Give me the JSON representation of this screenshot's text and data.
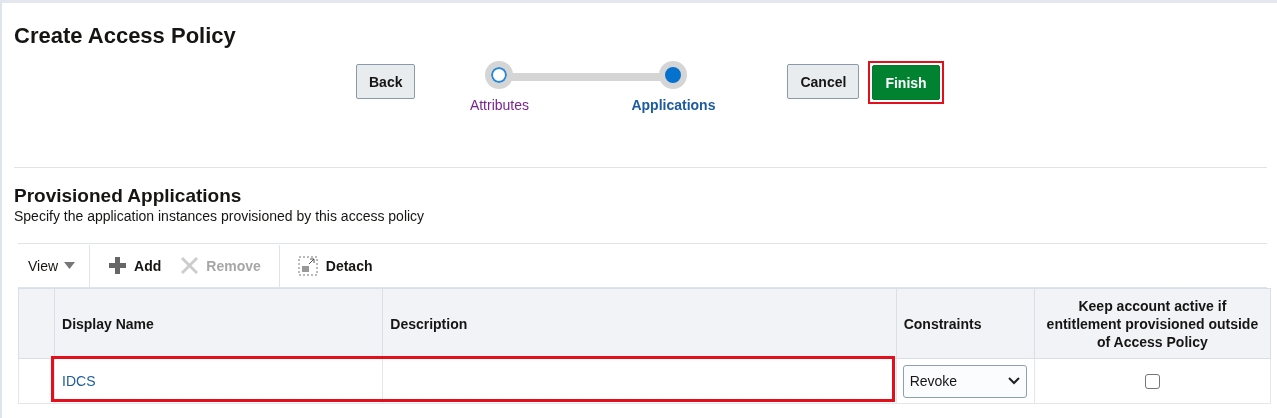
{
  "title": "Create Access Policy",
  "train": {
    "back": "Back",
    "steps": [
      {
        "label": "Attributes",
        "selected": false
      },
      {
        "label": "Applications",
        "selected": true
      }
    ],
    "cancel": "Cancel",
    "finish": {
      "label": "Finish",
      "highlighted": true
    }
  },
  "section": {
    "title": "Provisioned Applications",
    "description": "Specify the application instances provisioned by this access policy"
  },
  "toolbar": {
    "view": "View",
    "items": [
      {
        "kind": "add",
        "label": "Add",
        "disabled": false
      },
      {
        "kind": "remove",
        "label": "Remove",
        "disabled": true
      },
      {
        "kind": "detach",
        "label": "Detach",
        "disabled": false
      }
    ]
  },
  "table": {
    "columns": [
      "Display Name",
      "Description",
      "Constraints",
      "Keep account active if entitlement provisioned outside of Access Policy"
    ],
    "rows": [
      {
        "display_name": "IDCS",
        "constraint": "Revoke",
        "keep_active": false,
        "highlighted": true
      }
    ]
  }
}
